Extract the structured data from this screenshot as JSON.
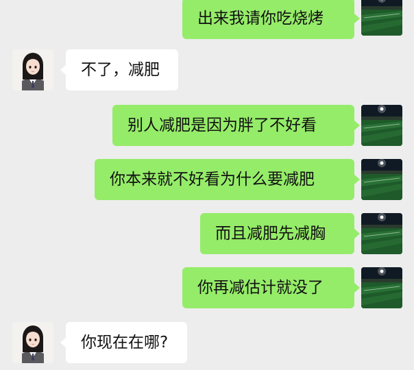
{
  "messages": [
    {
      "side": "out",
      "text": "出来我请你吃烧烤",
      "avatar": "stadium-avatar"
    },
    {
      "side": "in",
      "text": "不了，减肥",
      "avatar": "girl-avatar"
    },
    {
      "side": "out",
      "text": "别人减肥是因为胖了不好看",
      "avatar": "stadium-avatar"
    },
    {
      "side": "out",
      "text": "你本来就不好看为什么要减肥",
      "avatar": "stadium-avatar"
    },
    {
      "side": "out",
      "text": "而且减肥先减胸",
      "avatar": "stadium-avatar"
    },
    {
      "side": "out",
      "text": "你再减估计就没了",
      "avatar": "stadium-avatar"
    },
    {
      "side": "in",
      "text": "你现在在哪?",
      "avatar": "girl-avatar"
    }
  ],
  "colors": {
    "background": "#ededed",
    "outgoing_bubble": "#95ec69",
    "incoming_bubble": "#ffffff"
  }
}
